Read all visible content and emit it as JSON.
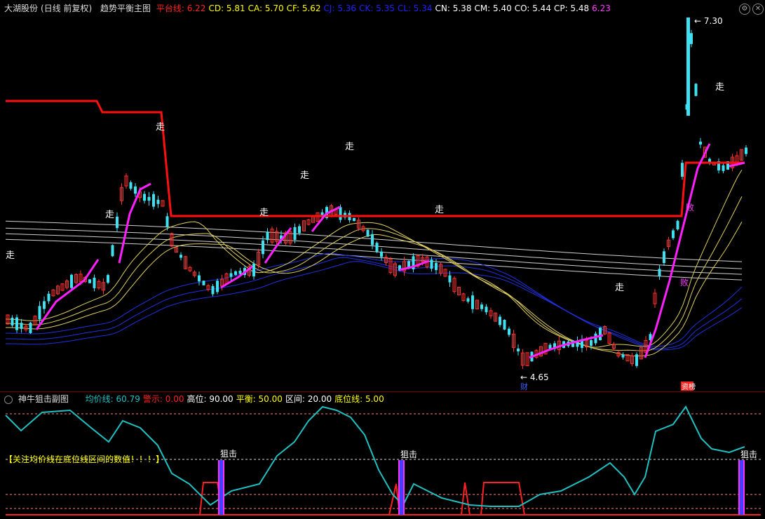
{
  "main": {
    "stock_name": "大湖股份",
    "period": "(日线 前复权)",
    "indicator_name": "趋势平衡主图",
    "readouts": [
      {
        "label": "平台线:",
        "value": "6.22",
        "color": "#ff2020"
      },
      {
        "label": "CD:",
        "value": "5.81",
        "color": "#ffff00"
      },
      {
        "label": "CA:",
        "value": "5.70",
        "color": "#ffff00"
      },
      {
        "label": "CF:",
        "value": "5.62",
        "color": "#ffff00"
      },
      {
        "label": "CJ:",
        "value": "5.36",
        "color": "#2020ff"
      },
      {
        "label": "CK:",
        "value": "5.35",
        "color": "#2020ff"
      },
      {
        "label": "CL:",
        "value": "5.34",
        "color": "#2020ff"
      },
      {
        "label": "CN:",
        "value": "5.38",
        "color": "#ffffff"
      },
      {
        "label": "CM:",
        "value": "5.40",
        "color": "#ffffff"
      },
      {
        "label": "CO:",
        "value": "5.44",
        "color": "#ffffff"
      },
      {
        "label": "CP:",
        "value": "5.48",
        "color": "#ffffff"
      },
      {
        "label": "",
        "value": "6.23",
        "color": "#ff40ff"
      }
    ],
    "high_label": "7.30",
    "low_label": "4.65",
    "walk_label": "走",
    "fail_label": "败",
    "cai_tag": "财",
    "news_tag": "资榜"
  },
  "sub": {
    "indicator_name": "神牛狙击副图",
    "readouts": [
      {
        "label": "均价线:",
        "value": "60.79",
        "color": "#20c0c0"
      },
      {
        "label": "警示:",
        "value": "0.00",
        "color": "#ff2020"
      },
      {
        "label": "高位:",
        "value": "90.00",
        "color": "#ffffff"
      },
      {
        "label": "平衡:",
        "value": "50.00",
        "color": "#ffff00"
      },
      {
        "label": "区间:",
        "value": "20.00",
        "color": "#ffffff"
      },
      {
        "label": "底位线:",
        "value": "5.00",
        "color": "#ffff00"
      }
    ],
    "notice": "【关注均价线在底位线区间的数值！！！】",
    "snipe_label": "狙击"
  },
  "colors": {
    "up": "#ff3030",
    "down": "#40e0f0",
    "platform": "#ff1010",
    "trend": "#ff20ff",
    "ma_yellow": "#e0d060",
    "ma_blue": "#2030e0",
    "ma_white": "#d0d0d0",
    "avg": "#20c0c0"
  }
}
